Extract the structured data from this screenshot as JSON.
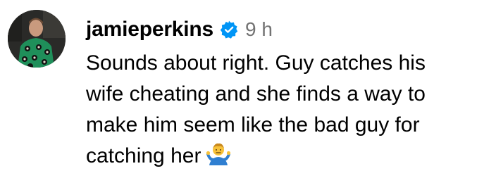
{
  "comment": {
    "username": "jamieperkins",
    "verified_icon": "verified-badge-icon",
    "timestamp": "9 h",
    "text_lines": [
      "Sounds about right. Guy catches his",
      "wife cheating and she finds a way to",
      "make him seem like the bad guy for",
      "catching her"
    ],
    "emoji_icon": "person-shrugging-emoji",
    "colors": {
      "username": "#000000",
      "timestamp": "#737373",
      "verified_badge": "#0095f6"
    }
  }
}
